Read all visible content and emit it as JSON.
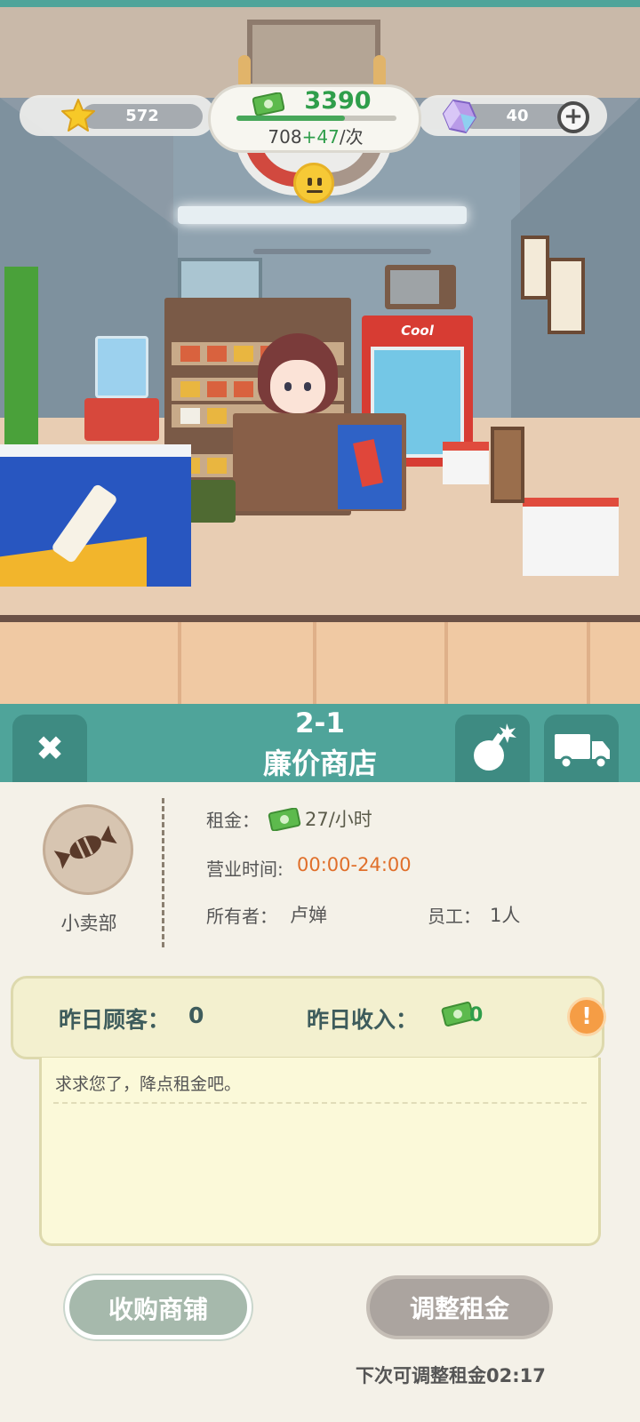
{
  "hud": {
    "stars": "572",
    "gems": "40",
    "money": "3390",
    "money_progress": 0.68,
    "rate_base": "708",
    "rate_plus": "+47",
    "rate_unit": "/次",
    "add_label": "+"
  },
  "header": {
    "shop_code": "2-1",
    "shop_name": "廉价商店",
    "close_glyph": "✖"
  },
  "shop": {
    "category": "小卖部",
    "rent_label": "租金：",
    "rent_value": "27/小时",
    "hours_label": "营业时间:",
    "hours_value": "00:00-24:00",
    "owner_label": "所有者：",
    "owner_value": "卢婵",
    "staff_label": "员工：",
    "staff_value": "1人"
  },
  "stats": {
    "customers_label": "昨日顾客：",
    "customers_value": "0",
    "income_label": "昨日收入：",
    "income_value": "0",
    "alert_glyph": "!"
  },
  "message": "求求您了，降点租金吧。",
  "buttons": {
    "buy": "收购商铺",
    "adjust": "调整租金"
  },
  "next_adjust": "下次可调整租金02:17",
  "scene": {
    "fridge_sign": "Cool"
  },
  "colors": {
    "teal": "#4fa49a",
    "money_green": "#2f9e4b",
    "orange": "#e06f2a"
  }
}
